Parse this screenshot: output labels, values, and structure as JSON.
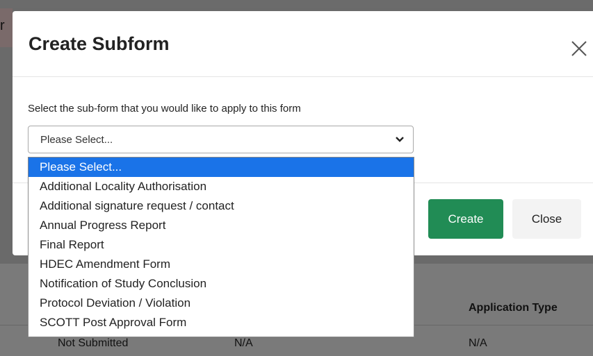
{
  "background": {
    "left_letter": "r",
    "table": {
      "header_application_type": "Application Type",
      "row": [
        "Not Submitted",
        "N/A",
        "N/A"
      ]
    }
  },
  "modal": {
    "title": "Create Subform",
    "close_icon": "close-icon",
    "prompt": "Select the sub-form that you would like to apply to this form",
    "select_value": "Please Select...",
    "create_label": "Create",
    "close_label": "Close"
  },
  "dropdown": {
    "options": [
      "Please Select...",
      "Additional Locality Authorisation",
      "Additional signature request / contact",
      "Annual Progress Report",
      "Final Report",
      "HDEC Amendment Form",
      "Notification of Study Conclusion",
      "Protocol Deviation / Violation",
      "SCOTT Post Approval Form"
    ],
    "selected_index": 0
  },
  "colors": {
    "primary_button": "#218c55",
    "selected_option": "#1a73e8"
  }
}
